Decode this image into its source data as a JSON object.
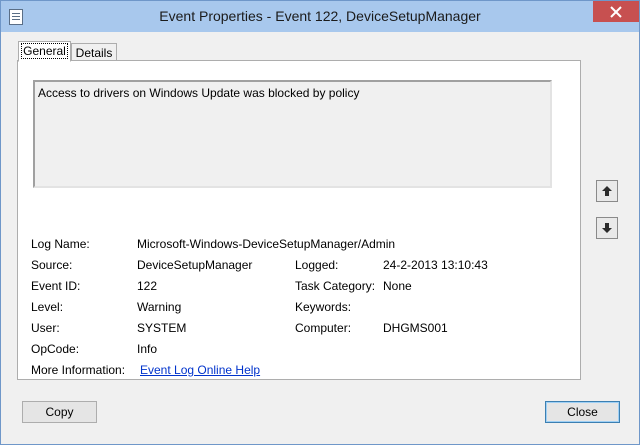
{
  "window": {
    "title": "Event Properties - Event 122, DeviceSetupManager",
    "close_label": "×"
  },
  "tabs": [
    {
      "label": "General",
      "active": true
    },
    {
      "label": "Details",
      "active": false
    }
  ],
  "event": {
    "description": "Access to drivers on Windows Update was blocked by policy",
    "fields": {
      "log_name_label": "Log Name:",
      "log_name": "Microsoft-Windows-DeviceSetupManager/Admin",
      "source_label": "Source:",
      "source": "DeviceSetupManager",
      "logged_label": "Logged:",
      "logged": "24-2-2013 13:10:43",
      "event_id_label": "Event ID:",
      "event_id": "122",
      "task_category_label": "Task Category:",
      "task_category": "None",
      "level_label": "Level:",
      "level": "Warning",
      "keywords_label": "Keywords:",
      "keywords": "",
      "user_label": "User:",
      "user": "SYSTEM",
      "computer_label": "Computer:",
      "computer": "DHGMS001",
      "opcode_label": "OpCode:",
      "opcode": "Info",
      "more_info_label": "More Information:",
      "more_info_link": "Event Log Online Help"
    }
  },
  "buttons": {
    "copy": "Copy",
    "close": "Close"
  },
  "icons": {
    "up": "arrow-up-icon",
    "down": "arrow-down-icon",
    "app": "event-log-icon"
  }
}
